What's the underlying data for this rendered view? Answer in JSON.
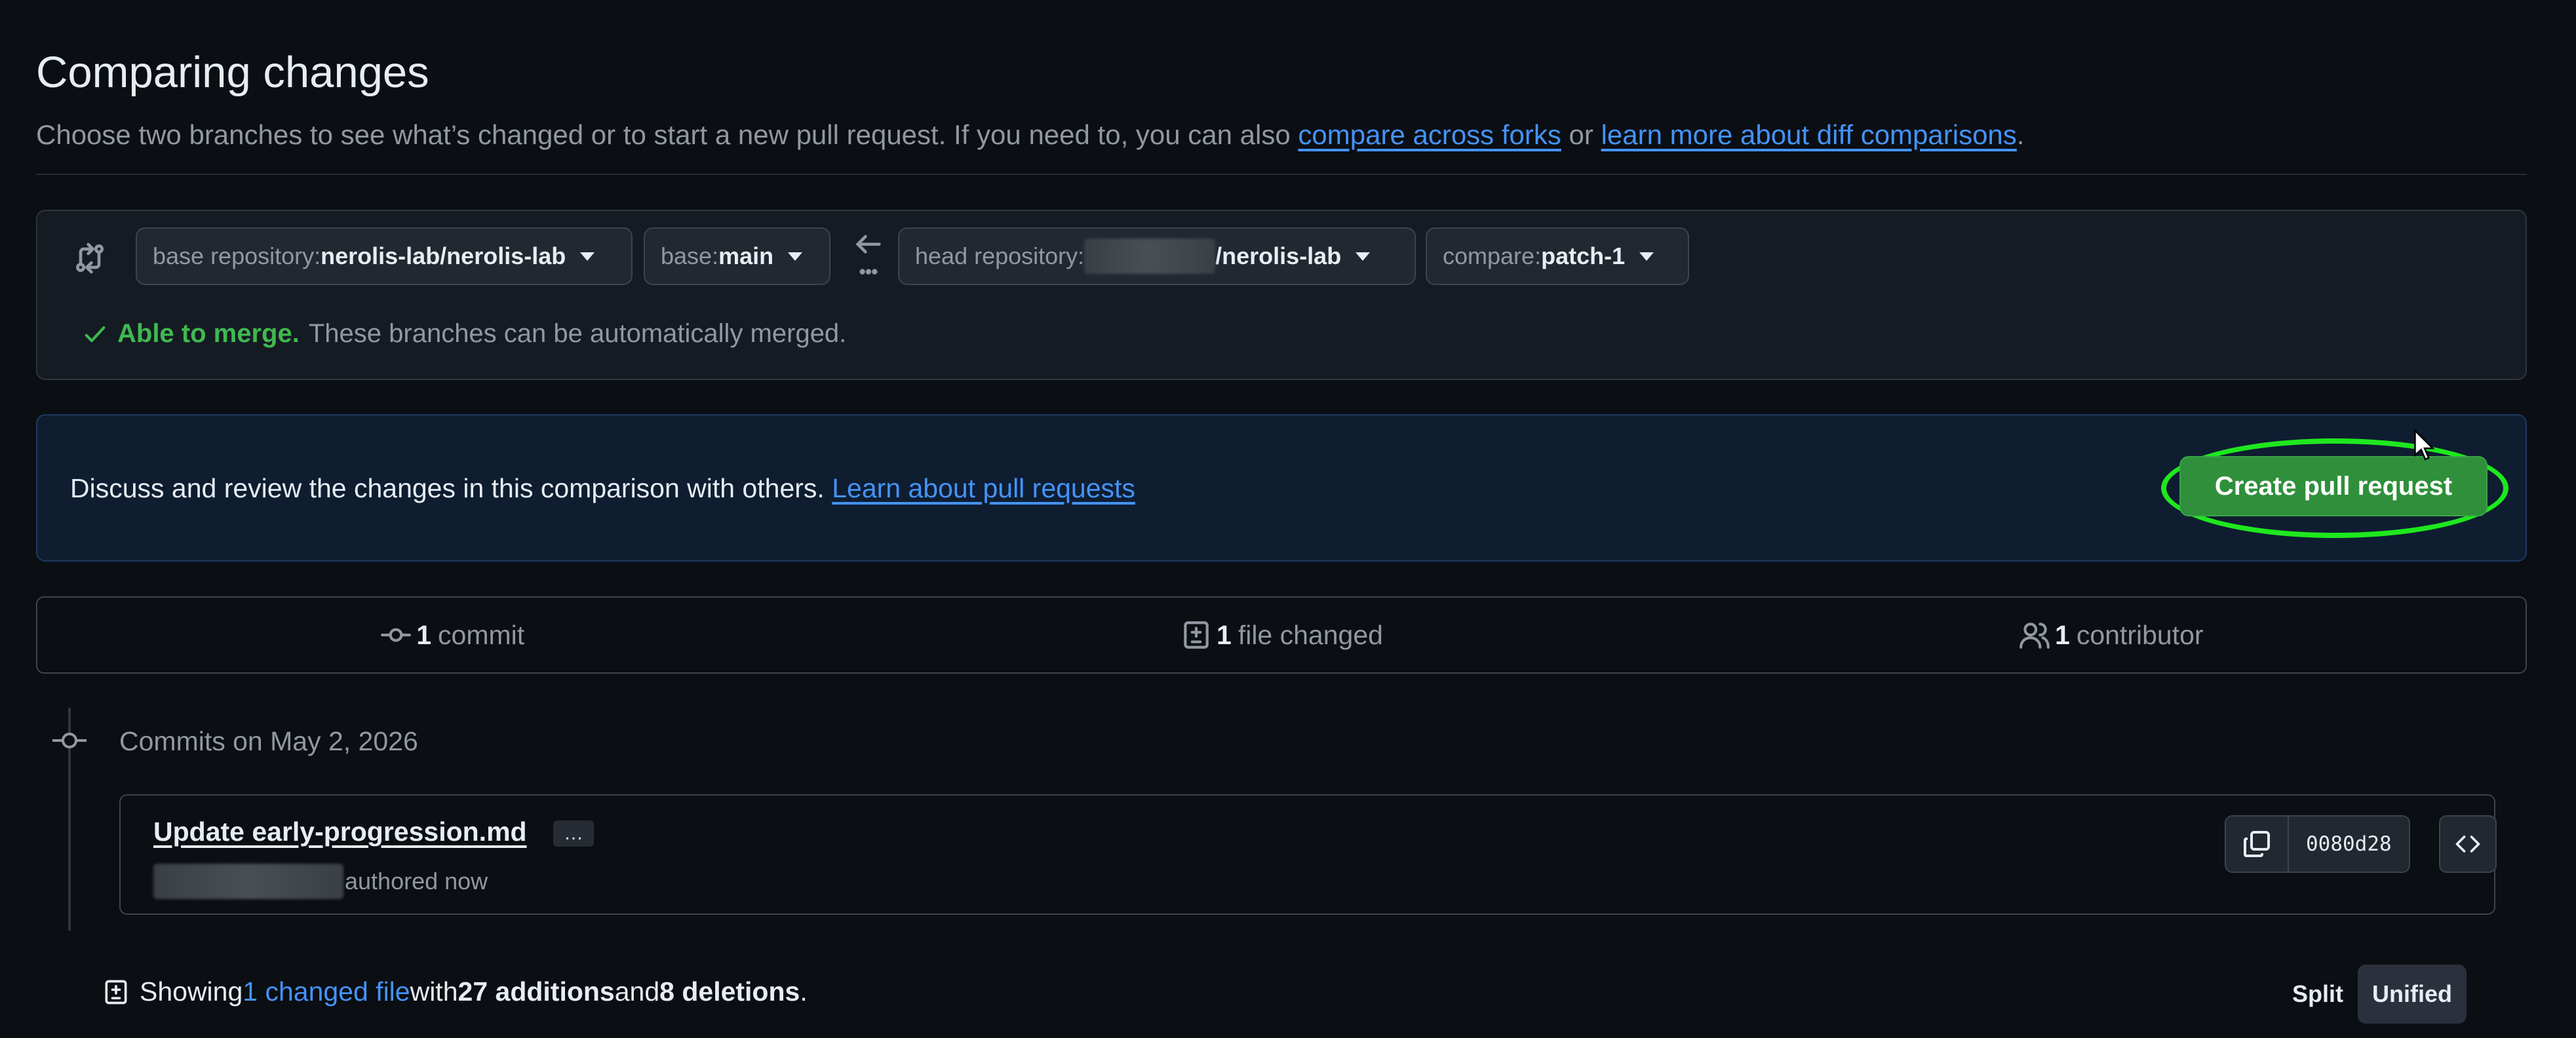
{
  "header": {
    "title": "Comparing changes",
    "subtitle_prefix": "Choose two branches to see what’s changed or to start a new pull request. If you need to, you can also ",
    "link_compare_forks": "compare across forks",
    "subtitle_or": " or ",
    "link_learn_diff": "learn more about diff comparisons",
    "subtitle_end": "."
  },
  "range": {
    "base_repo_label": "base repository: ",
    "base_repo_value": "nerolis-lab/nerolis-lab",
    "base_label": "base: ",
    "base_value": "main",
    "head_repo_label": "head repository: ",
    "head_repo_value": "/nerolis-lab",
    "compare_label": "compare: ",
    "compare_value": "patch-1",
    "merge_ok": "Able to merge.",
    "merge_text": "These branches can be automatically merged."
  },
  "discuss": {
    "text": "Discuss and review the changes in this comparison with others. ",
    "link": "Learn about pull requests",
    "button": "Create pull request"
  },
  "stats": {
    "commits_count": "1",
    "commits_label": "commit",
    "files_count": "1",
    "files_label": "file changed",
    "contributors_count": "1",
    "contributors_label": "contributor"
  },
  "commits": {
    "date_heading": "Commits on May 2, 2026",
    "title": "Update early-progression.md",
    "ellipsis": "…",
    "authored": "authored now",
    "sha": "0080d28"
  },
  "footer": {
    "showing": "Showing ",
    "changed_files": "1 changed file",
    "with": " with ",
    "additions": "27 additions",
    "and": " and ",
    "deletions": "8 deletions",
    "end": ".",
    "split_label": "Split",
    "unified_label": "Unified"
  },
  "colors": {
    "background": "#0b0e13",
    "link": "#4493f8",
    "success": "#3fb950",
    "cta_bg": "#2f8f3a",
    "highlight_ring": "#1ee81e"
  }
}
